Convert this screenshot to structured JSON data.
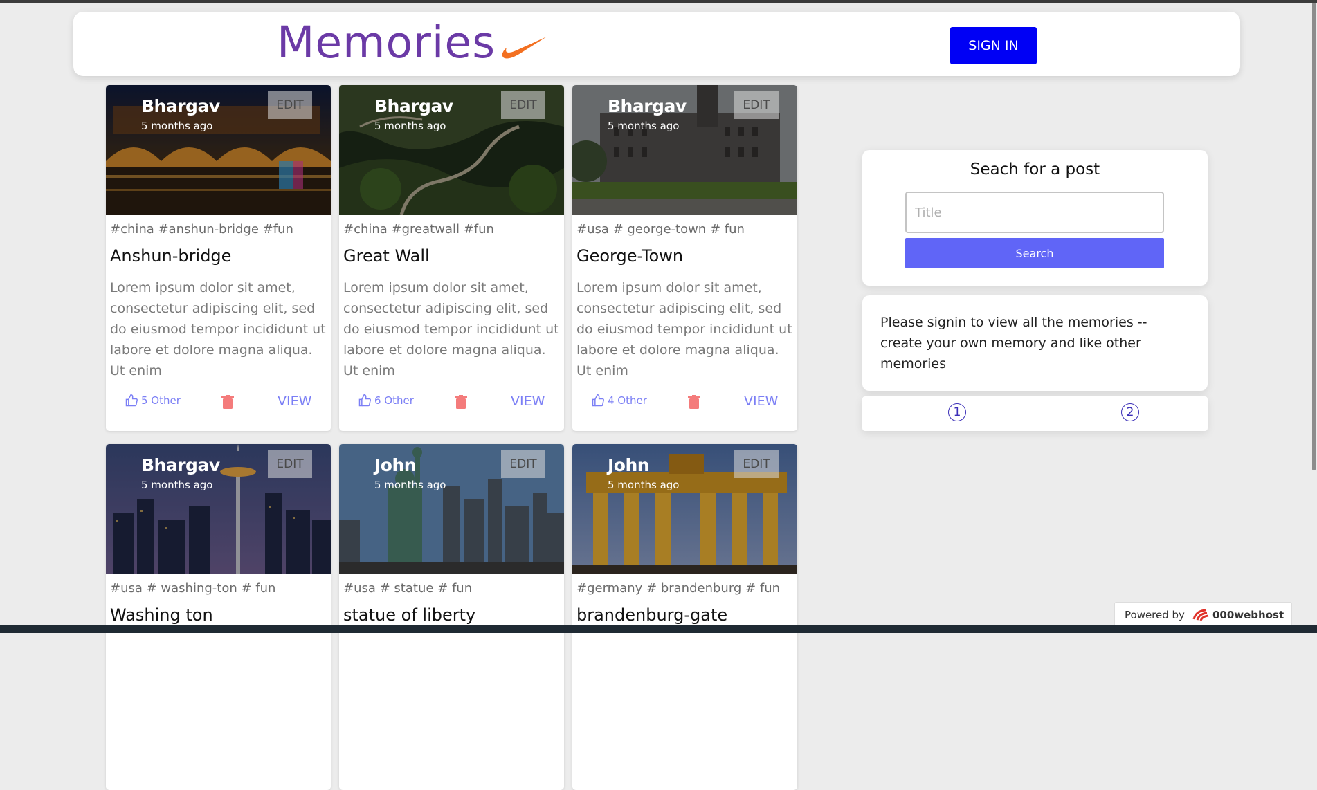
{
  "header": {
    "logo": "Memories",
    "signin_label": "SIGN IN"
  },
  "cards": [
    {
      "author": "Bhargav",
      "time": "5 months ago",
      "edit": "EDIT",
      "tags": "#china #anshun-bridge #fun",
      "title": "Anshun-bridge",
      "desc": "Lorem ipsum dolor sit amet, consectetur adipiscing elit, sed do eiusmod tempor incididunt ut labore et dolore magna aliqua. Ut enim",
      "likes": "5 Other",
      "view": "VIEW"
    },
    {
      "author": "Bhargav",
      "time": "5 months ago",
      "edit": "EDIT",
      "tags": "#china #greatwall #fun",
      "title": "Great Wall",
      "desc": "Lorem ipsum dolor sit amet, consectetur adipiscing elit, sed do eiusmod tempor incididunt ut labore et dolore magna aliqua. Ut enim",
      "likes": "6 Other",
      "view": "VIEW"
    },
    {
      "author": "Bhargav",
      "time": "5 months ago",
      "edit": "EDIT",
      "tags": "#usa # george-town # fun",
      "title": "George-Town",
      "desc": "Lorem ipsum dolor sit amet, consectetur adipiscing elit, sed do eiusmod tempor incididunt ut labore et dolore magna aliqua. Ut enim",
      "likes": "4 Other",
      "view": "VIEW"
    },
    {
      "author": "Bhargav",
      "time": "5 months ago",
      "edit": "EDIT",
      "tags": "#usa # washing-ton # fun",
      "title": "Washing ton",
      "desc": "",
      "likes": "",
      "view": ""
    },
    {
      "author": "John",
      "time": "5 months ago",
      "edit": "EDIT",
      "tags": "#usa # statue # fun",
      "title": "statue of liberty",
      "desc": "",
      "likes": "",
      "view": ""
    },
    {
      "author": "John",
      "time": "5 months ago",
      "edit": "EDIT",
      "tags": "#germany # brandenburg # fun",
      "title": "brandenburg-gate",
      "desc": "",
      "likes": "",
      "view": ""
    }
  ],
  "search": {
    "title": "Seach for a post",
    "placeholder": "Title",
    "value": "",
    "button": "Search"
  },
  "info": {
    "text": "Please signin to view all the memories -- create your own memory and like other memories"
  },
  "pagination": {
    "pages": [
      "1",
      "2"
    ]
  },
  "footer_badge": {
    "powered_by": "Powered by",
    "brand": "000webhost"
  },
  "colors": {
    "accent": "#6065f7",
    "brand_purple": "#6b3aa6",
    "signin_blue": "#0000f5",
    "delete_red": "#f47b7b",
    "swoosh_orange": "#f37021"
  },
  "icons": {
    "like": "thumbs-up-icon",
    "delete": "trash-icon",
    "logo": "swoosh-icon"
  }
}
